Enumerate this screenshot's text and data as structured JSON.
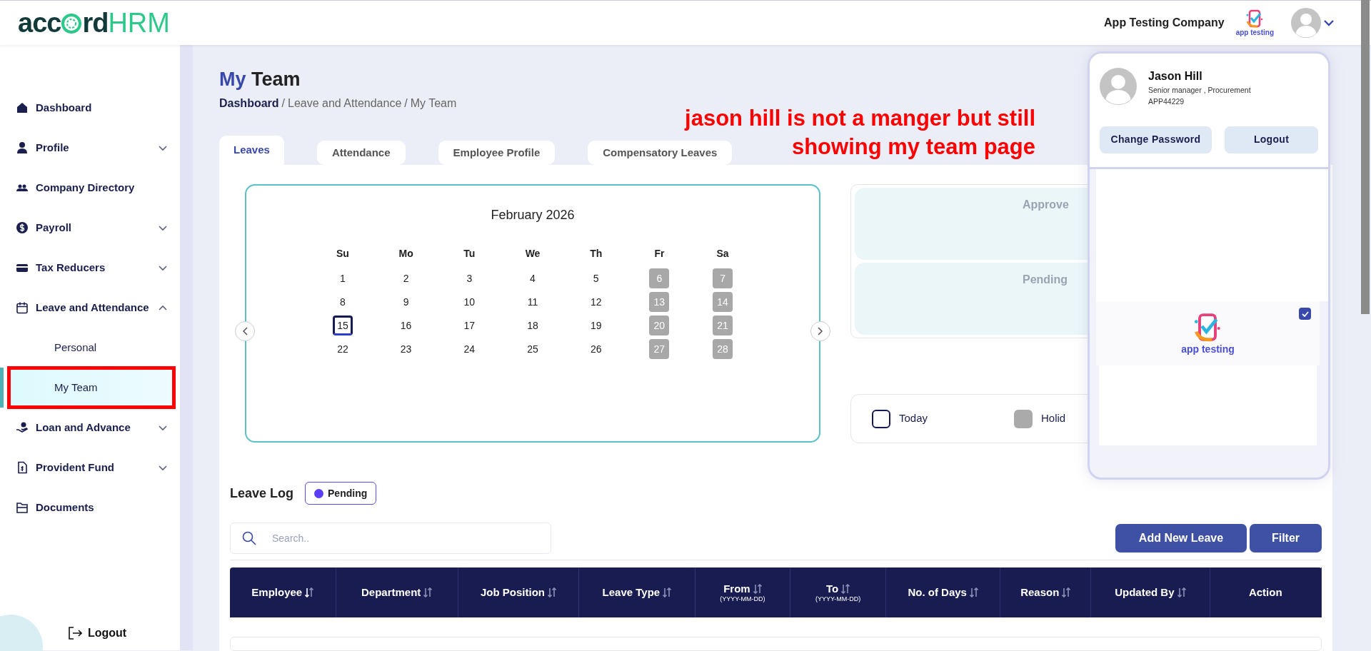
{
  "header": {
    "logo": {
      "part_1": "acc",
      "part_2": "rd",
      "part_3": "HRM"
    },
    "company_name": "App Testing Company",
    "company_logo_text": "app testing"
  },
  "sidebar": {
    "items": [
      {
        "label": "Dashboard"
      },
      {
        "label": "Profile",
        "expanded": false
      },
      {
        "label": "Company Directory"
      },
      {
        "label": "Payroll",
        "expanded": false
      },
      {
        "label": "Tax Reducers",
        "expanded": false
      },
      {
        "label": "Leave and Attendance",
        "expanded": true,
        "children": [
          {
            "label": "Personal",
            "selected": false
          },
          {
            "label": "My Team",
            "selected": true
          }
        ]
      },
      {
        "label": "Loan and Advance",
        "expanded": false
      },
      {
        "label": "Provident Fund",
        "expanded": false
      },
      {
        "label": "Documents"
      }
    ],
    "logout": "Logout"
  },
  "page": {
    "title": {
      "accent": "My",
      "rest": "Team"
    },
    "breadcrumb": [
      {
        "label": "Dashboard"
      },
      {
        "label": "Leave and Attendance"
      },
      {
        "label": "My Team"
      }
    ],
    "separator": "/"
  },
  "annotation": {
    "lines": [
      "jason hill is not a manger but still",
      "showing my team page"
    ]
  },
  "tabs": [
    {
      "label": "Leaves",
      "selected": true
    },
    {
      "label": "Attendance",
      "selected": false
    },
    {
      "label": "Employee Profile",
      "selected": false
    },
    {
      "label": "Compensatory Leaves",
      "selected": false
    }
  ],
  "calendar": {
    "month": "February 2026",
    "weekdays": [
      "Su",
      "Mo",
      "Tu",
      "We",
      "Th",
      "Fr",
      "Sa"
    ],
    "weeks": [
      [
        {
          "day": "1",
          "today": false,
          "holiday": false
        },
        {
          "day": "2",
          "today": false,
          "holiday": false
        },
        {
          "day": "3",
          "today": false,
          "holiday": false
        },
        {
          "day": "4",
          "today": false,
          "holiday": false
        },
        {
          "day": "5",
          "today": false,
          "holiday": false
        },
        {
          "day": "6",
          "today": false,
          "holiday": true
        },
        {
          "day": "7",
          "today": false,
          "holiday": true
        }
      ],
      [
        {
          "day": "8",
          "today": false,
          "holiday": false
        },
        {
          "day": "9",
          "today": false,
          "holiday": false
        },
        {
          "day": "10",
          "today": false,
          "holiday": false
        },
        {
          "day": "11",
          "today": false,
          "holiday": false
        },
        {
          "day": "12",
          "today": false,
          "holiday": false
        },
        {
          "day": "13",
          "today": false,
          "holiday": true
        },
        {
          "day": "14",
          "today": false,
          "holiday": true
        }
      ],
      [
        {
          "day": "15",
          "today": true,
          "holiday": false
        },
        {
          "day": "16",
          "today": false,
          "holiday": false
        },
        {
          "day": "17",
          "today": false,
          "holiday": false
        },
        {
          "day": "18",
          "today": false,
          "holiday": false
        },
        {
          "day": "19",
          "today": false,
          "holiday": false
        },
        {
          "day": "20",
          "today": false,
          "holiday": true
        },
        {
          "day": "21",
          "today": false,
          "holiday": true
        }
      ],
      [
        {
          "day": "22",
          "today": false,
          "holiday": false
        },
        {
          "day": "23",
          "today": false,
          "holiday": false
        },
        {
          "day": "24",
          "today": false,
          "holiday": false
        },
        {
          "day": "25",
          "today": false,
          "holiday": false
        },
        {
          "day": "26",
          "today": false,
          "holiday": false
        },
        {
          "day": "27",
          "today": false,
          "holiday": true
        },
        {
          "day": "28",
          "today": false,
          "holiday": true
        }
      ]
    ]
  },
  "stats": [
    {
      "label": "Approve"
    },
    {
      "label": "Pending"
    }
  ],
  "legend": [
    {
      "label": "Today",
      "kind": "today"
    },
    {
      "label": "Holid",
      "kind": "holiday"
    }
  ],
  "leave_log": {
    "title": "Leave Log",
    "filter": {
      "label": "Pending",
      "color": "#5b3df5"
    },
    "search": {
      "placeholder": "Search.."
    },
    "buttons": [
      "Add New Leave",
      "Filter"
    ]
  },
  "table": {
    "columns": [
      {
        "label": "Employee",
        "sorted": true
      },
      {
        "label": "Department",
        "sorted": false
      },
      {
        "label": "Job Position",
        "sorted": false
      },
      {
        "label": "Leave Type",
        "sorted": false
      },
      {
        "label": "From",
        "sub": "(YYYY-MM-DD)",
        "sorted": false
      },
      {
        "label": "To",
        "sub": "(YYYY-MM-DD)",
        "sorted": false
      },
      {
        "label": "No. of Days",
        "sorted": false
      },
      {
        "label": "Reason",
        "sorted": false
      },
      {
        "label": "Updated By",
        "sorted": false
      },
      {
        "label": "Action"
      }
    ]
  },
  "profile_menu": {
    "name": "Jason Hill",
    "role": "Senior manager , Procurement",
    "employee_id": "APP44229",
    "buttons": [
      "Change Password",
      "Logout"
    ],
    "companies": [
      {
        "logo_text": "app testing",
        "checked": true
      }
    ]
  }
}
